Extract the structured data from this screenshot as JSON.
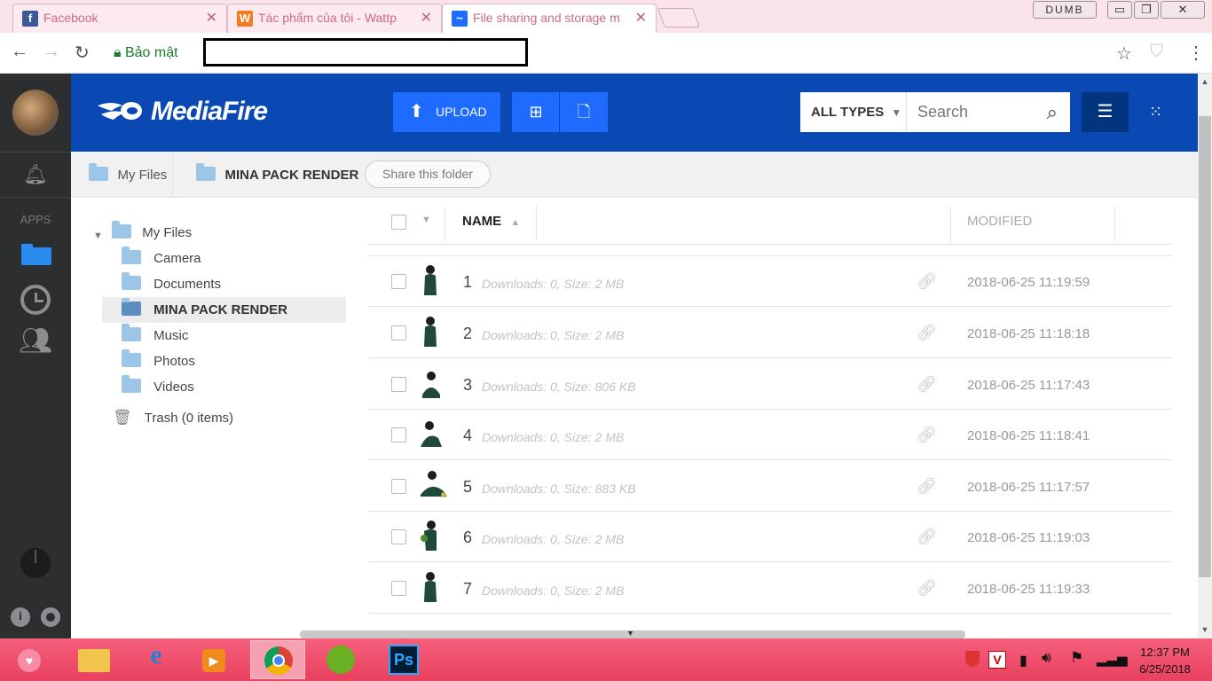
{
  "browser": {
    "tabs": [
      {
        "title": "Facebook",
        "icon": "facebook-icon",
        "color": "#3b5998",
        "glyph": "f"
      },
      {
        "title": "Tác phẩm của tôi - Wattp",
        "icon": "wattpad-icon",
        "color": "#f57b20",
        "glyph": "W"
      },
      {
        "title": "File sharing and storage m",
        "icon": "mediafire-icon",
        "color": "#1f6bff",
        "glyph": "~"
      }
    ],
    "profile_label": "DUMB",
    "secure_label": "Bảo mật"
  },
  "header": {
    "logo": "MediaFire",
    "upload_label": "UPLOAD",
    "types_label": "ALL TYPES",
    "search_placeholder": "Search"
  },
  "rail": {
    "apps_label": "APPS"
  },
  "breadcrumb": {
    "root": "My Files",
    "current": "MINA PACK RENDER",
    "share_label": "Share this folder"
  },
  "tree": {
    "root": "My Files",
    "items": [
      "Camera",
      "Documents",
      "MINA PACK RENDER",
      "Music",
      "Photos",
      "Videos"
    ],
    "trash": "Trash (0 items)"
  },
  "table": {
    "col_name": "NAME",
    "col_modified": "MODIFIED",
    "rows": [
      {
        "name": "1",
        "meta": "Downloads: 0, Size: 2 MB",
        "modified": "2018-06-25 11:19:59"
      },
      {
        "name": "2",
        "meta": "Downloads: 0, Size: 2 MB",
        "modified": "2018-06-25 11:18:18"
      },
      {
        "name": "3",
        "meta": "Downloads: 0, Size: 806 KB",
        "modified": "2018-06-25 11:17:43"
      },
      {
        "name": "4",
        "meta": "Downloads: 0, Size: 2 MB",
        "modified": "2018-06-25 11:18:41"
      },
      {
        "name": "5",
        "meta": "Downloads: 0, Size: 883 KB",
        "modified": "2018-06-25 11:17:57"
      },
      {
        "name": "6",
        "meta": "Downloads: 0, Size: 2 MB",
        "modified": "2018-06-25 11:19:03"
      },
      {
        "name": "7",
        "meta": "Downloads: 0, Size: 2 MB",
        "modified": "2018-06-25 11:19:33"
      }
    ]
  },
  "taskbar": {
    "time": "12:37 PM",
    "date": "6/25/2018"
  },
  "colors": {
    "brand": "#0a49b3",
    "accent": "#1f6bff",
    "taskbar": "#ea4560"
  }
}
